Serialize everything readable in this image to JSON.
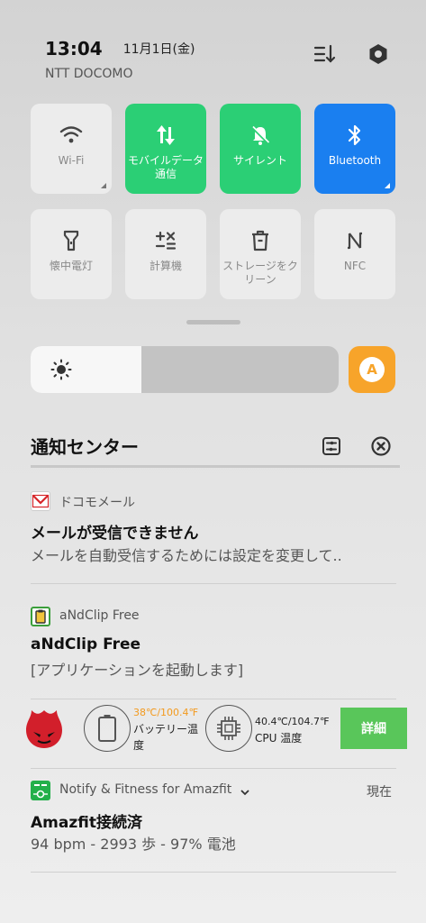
{
  "status": {
    "time": "13:04",
    "date": "11月1日(金)",
    "carrier": "NTT DOCOMO"
  },
  "quick_tiles": [
    {
      "label": "Wi-Fi",
      "icon": "wifi-icon",
      "state": "off"
    },
    {
      "label": "モバイルデータ通信",
      "icon": "mobile-data-icon",
      "state": "on"
    },
    {
      "label": "サイレント",
      "icon": "silent-bell-icon",
      "state": "on"
    },
    {
      "label": "Bluetooth",
      "icon": "bluetooth-icon",
      "state": "on"
    },
    {
      "label": "懐中電灯",
      "icon": "flashlight-icon",
      "state": "off"
    },
    {
      "label": "計算機",
      "icon": "calculator-icon",
      "state": "off"
    },
    {
      "label": "ストレージをクリーン",
      "icon": "trash-icon",
      "state": "off"
    },
    {
      "label": "NFC",
      "icon": "nfc-icon",
      "state": "off"
    }
  ],
  "brightness": {
    "level": 0.36,
    "auto_label": "A"
  },
  "notification_center": {
    "title": "通知センター"
  },
  "notifications": [
    {
      "app": "ドコモメール",
      "title": "メールが受信できません",
      "body": "メールを自動受信するためには設定を変更して.."
    },
    {
      "app": "aNdClip Free",
      "title": "aNdClip Free",
      "body": "[アプリケーションを起動します]"
    },
    {
      "app": "Notify & Fitness for Amazfit",
      "time": "現在",
      "title": "Amazfit接続済",
      "body": "94 bpm - 2993 歩 - 97% 電池"
    }
  ],
  "antutu": {
    "battery_temp": "38℃/100.4℉",
    "battery_label": "バッテリー温度",
    "cpu_temp": "40.4℃/104.7℉",
    "cpu_label": "CPU 温度",
    "detail_button": "詳細"
  },
  "colors": {
    "green": "#2bcf75",
    "blue": "#1a7ff0",
    "orange": "#f7a42a",
    "antutu_orange": "#f39a1e",
    "detail_green": "#59c65a"
  }
}
